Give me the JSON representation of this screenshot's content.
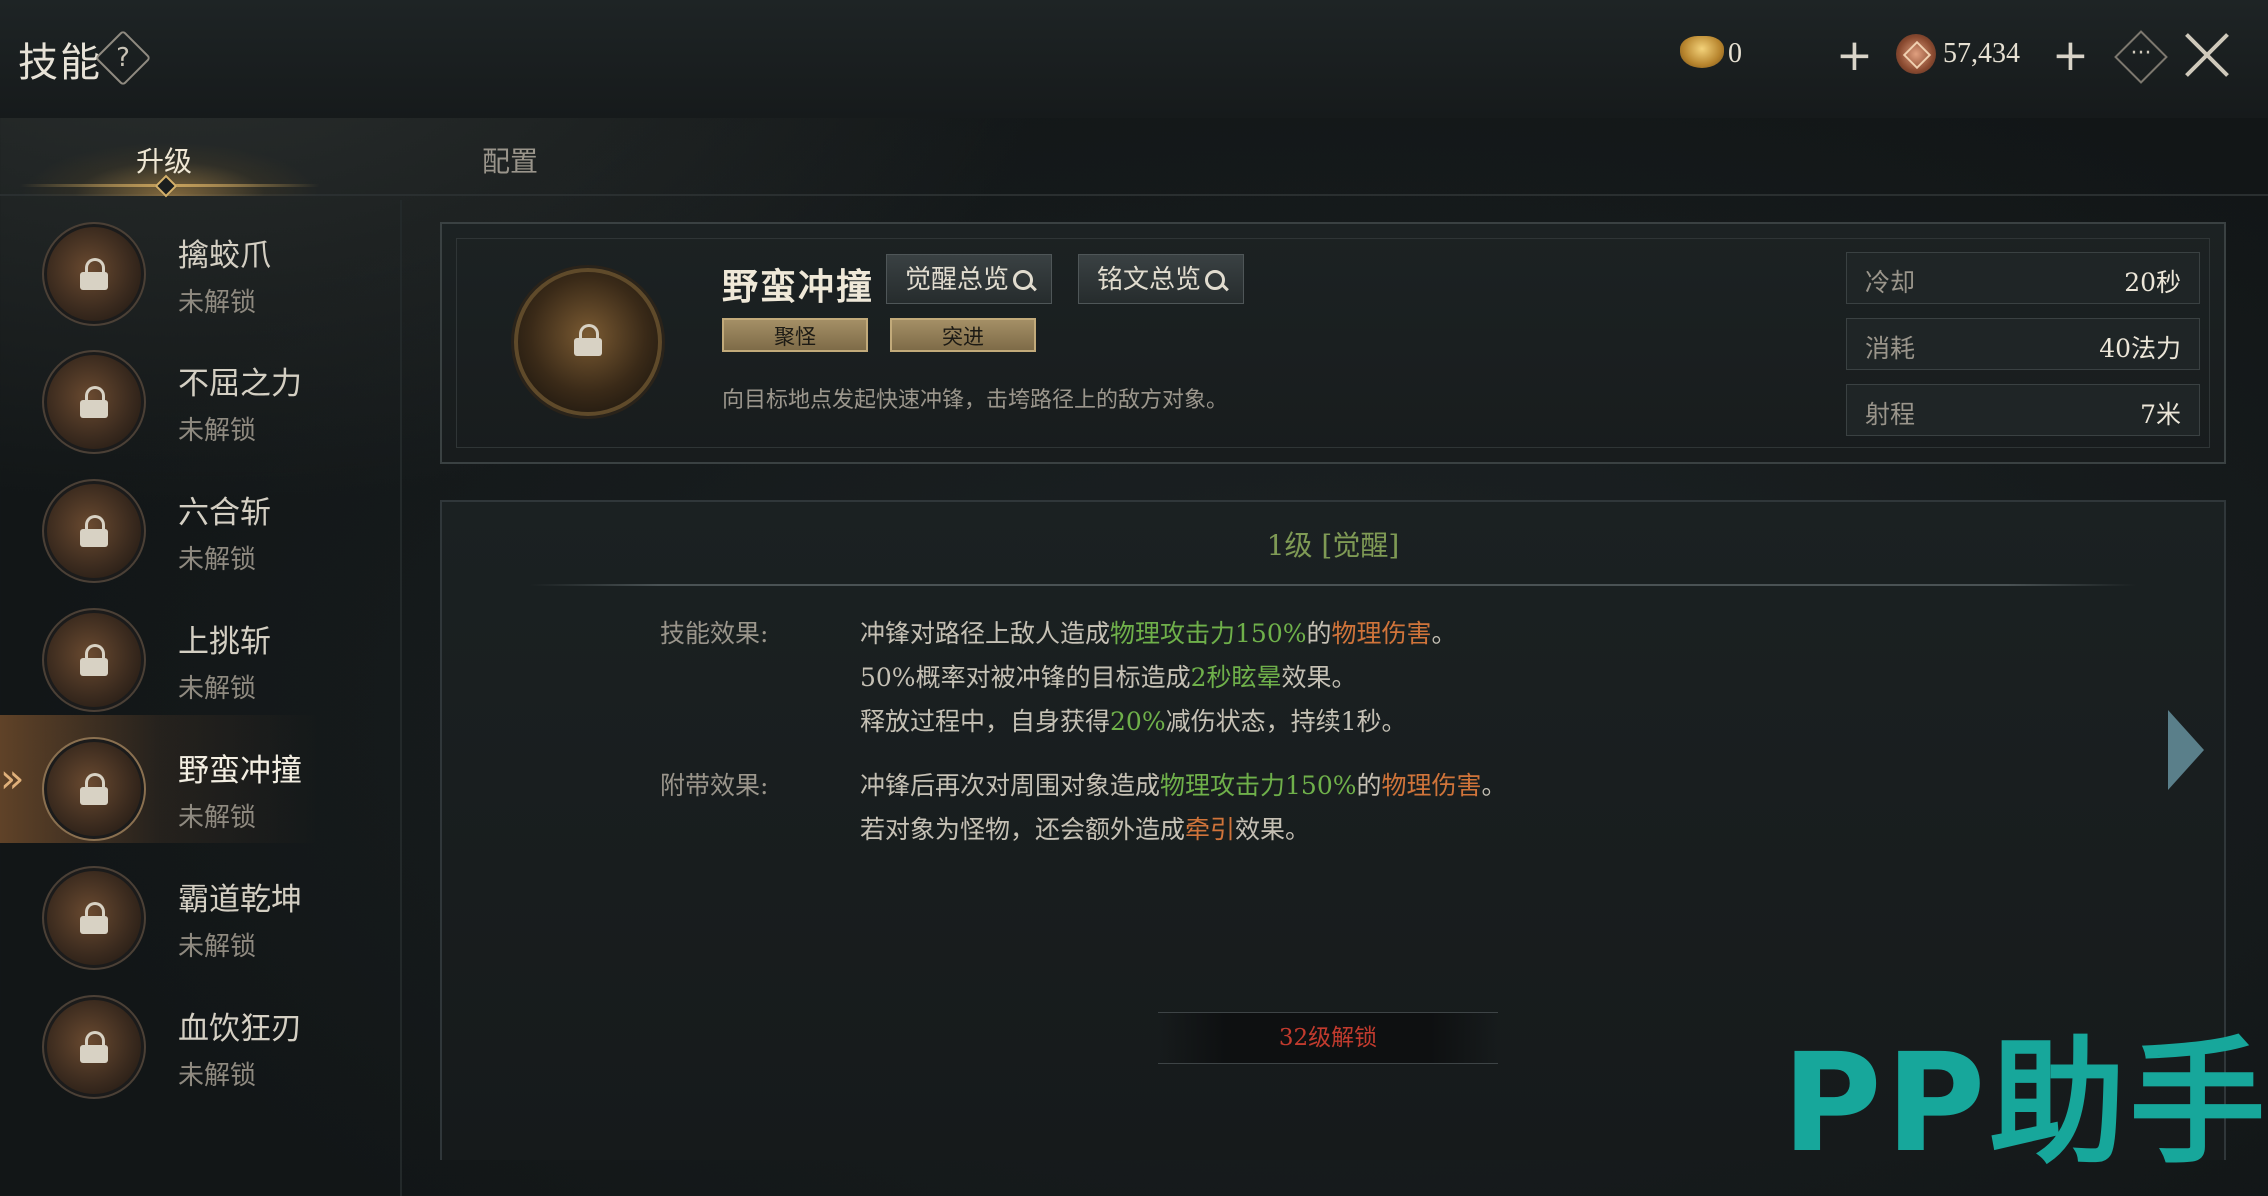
{
  "header": {
    "title": "技能",
    "help_symbol": "?",
    "currency_gold": {
      "icon": "gold-ingot-icon",
      "value": "0"
    },
    "currency_coin": {
      "icon": "coin-icon",
      "value": "57,434"
    },
    "plus_symbol": "+",
    "more_symbol": "···"
  },
  "tabs": [
    {
      "label": "升级",
      "active": true
    },
    {
      "label": "配置",
      "active": false
    }
  ],
  "sidebar": {
    "items": [
      {
        "name": "擒蛟爪",
        "status": "未解锁",
        "active": false
      },
      {
        "name": "不屈之力",
        "status": "未解锁",
        "active": false
      },
      {
        "name": "六合斩",
        "status": "未解锁",
        "active": false
      },
      {
        "name": "上挑斩",
        "status": "未解锁",
        "active": false
      },
      {
        "name": "野蛮冲撞",
        "status": "未解锁",
        "active": true
      },
      {
        "name": "霸道乾坤",
        "status": "未解锁",
        "active": false
      },
      {
        "name": "血饮狂刃",
        "status": "未解锁",
        "active": false
      }
    ],
    "active_marker": "»"
  },
  "detail": {
    "name": "野蛮冲撞",
    "awaken_overview": "觉醒总览",
    "inscription_overview": "铭文总览",
    "tags": [
      "聚怪",
      "突进"
    ],
    "description": "向目标地点发起快速冲锋，击垮路径上的敌方对象。",
    "stats": [
      {
        "key": "冷却",
        "value": "20秒"
      },
      {
        "key": "消耗",
        "value": "40法力"
      },
      {
        "key": "射程",
        "value": "7米"
      }
    ]
  },
  "effects": {
    "level_title": "1级 [觉醒]",
    "skill_effect_label": "技能效果:",
    "extra_effect_label": "附带效果:",
    "skill_lines": {
      "l1": {
        "a": "冲锋对路径上敌人造成",
        "b": "物理攻击力150%",
        "c": "的",
        "d": "物理伤害",
        "e": "。"
      },
      "l2": {
        "a": "50%概率对被冲锋的目标造成",
        "b": "2秒眩晕",
        "c": "效果。"
      },
      "l3": {
        "a": "释放过程中，自身获得",
        "b": "20%",
        "c": "减伤状态，持续1秒。"
      }
    },
    "extra_lines": {
      "l1": {
        "a": "冲锋后再次对周围对象造成",
        "b": "物理攻击力150%",
        "c": "的",
        "d": "物理伤害",
        "e": "。"
      },
      "l2": {
        "a": "若对象为怪物，还会额外造成",
        "b": "牵引",
        "c": "效果。"
      }
    },
    "unlock_text": "32级解锁"
  },
  "watermark": "PP助手",
  "colors": {
    "highlight_green": "#6fb04a",
    "highlight_orange": "#d0743a",
    "unlock_red": "#c23b2e",
    "watermark": "#17a79b"
  }
}
